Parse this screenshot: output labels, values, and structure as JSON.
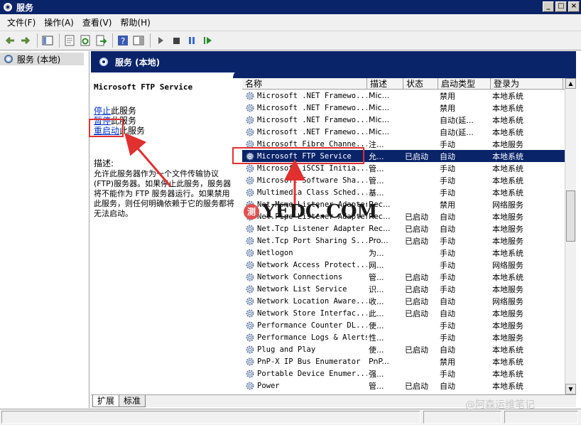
{
  "window": {
    "title": "服务",
    "buttons": [
      "_",
      "□",
      "×"
    ]
  },
  "menu": [
    "文件(F)",
    "操作(A)",
    "查看(V)",
    "帮助(H)"
  ],
  "toolbar": {
    "icons": [
      "back-icon",
      "forward-icon",
      "show-tree-icon",
      "properties-icon",
      "refresh-icon",
      "export-icon",
      "help-icon",
      "show-hide-icon",
      "start-icon",
      "stop-icon",
      "pause-icon",
      "restart-icon"
    ]
  },
  "tree": {
    "root_label": "服务 (本地)"
  },
  "main_header": {
    "label": "服务 (本地)"
  },
  "detail": {
    "service_title": "Microsoft FTP Service",
    "stop_link": "停止",
    "stop_suffix": "此服务",
    "pause_link": "暂停",
    "pause_suffix": "此服务",
    "restart_link": "重启动",
    "restart_suffix": "此服务",
    "desc_label": "描述:",
    "desc_text": "允许此服务器作为一个文件传输协议(FTP)服务器。如果停止此服务，服务器将不能作为 FTP 服务器运行。如果禁用此服务，则任何明确依赖于它的服务都将无法启动。"
  },
  "list": {
    "columns": [
      "名称",
      "描述",
      "状态",
      "启动类型",
      "登录为"
    ],
    "rows": [
      {
        "name": "Microsoft .NET Framewo...",
        "desc": "Mic...",
        "status": "",
        "type": "禁用",
        "logon": "本地系统"
      },
      {
        "name": "Microsoft .NET Framewo...",
        "desc": "Mic...",
        "status": "",
        "type": "禁用",
        "logon": "本地系统"
      },
      {
        "name": "Microsoft .NET Framewo...",
        "desc": "Mic...",
        "status": "",
        "type": "自动(延...",
        "logon": "本地系统"
      },
      {
        "name": "Microsoft .NET Framewo...",
        "desc": "Mic...",
        "status": "",
        "type": "自动(延...",
        "logon": "本地系统"
      },
      {
        "name": "Microsoft Fibre Channe...",
        "desc": "注...",
        "status": "",
        "type": "手动",
        "logon": "本地服务"
      },
      {
        "name": "Microsoft FTP Service",
        "desc": "允...",
        "status": "已启动",
        "type": "自动",
        "logon": "本地系统"
      },
      {
        "name": "Microsoft iSCSI Initia...",
        "desc": "管...",
        "status": "",
        "type": "手动",
        "logon": "本地系统"
      },
      {
        "name": "Microsoft Software Sha...",
        "desc": "管...",
        "status": "",
        "type": "手动",
        "logon": "本地系统"
      },
      {
        "name": "Multimedia Class Sched...",
        "desc": "基...",
        "status": "",
        "type": "手动",
        "logon": "本地系统"
      },
      {
        "name": "Net.Msmq Listener Adapter",
        "desc": "Rec...",
        "status": "",
        "type": "禁用",
        "logon": "网络服务"
      },
      {
        "name": "Net.Pipe Listener Adapter",
        "desc": "Rec...",
        "status": "已启动",
        "type": "自动",
        "logon": "本地服务"
      },
      {
        "name": "Net.Tcp Listener Adapter",
        "desc": "Rec...",
        "status": "已启动",
        "type": "自动",
        "logon": "本地服务"
      },
      {
        "name": "Net.Tcp Port Sharing S...",
        "desc": "Pro...",
        "status": "已启动",
        "type": "手动",
        "logon": "本地服务"
      },
      {
        "name": "Netlogon",
        "desc": "为...",
        "status": "",
        "type": "手动",
        "logon": "本地系统"
      },
      {
        "name": "Network Access Protect...",
        "desc": "网...",
        "status": "",
        "type": "手动",
        "logon": "网络服务"
      },
      {
        "name": "Network Connections",
        "desc": "管...",
        "status": "已启动",
        "type": "手动",
        "logon": "本地系统"
      },
      {
        "name": "Network List Service",
        "desc": "识...",
        "status": "已启动",
        "type": "手动",
        "logon": "本地服务"
      },
      {
        "name": "Network Location Aware...",
        "desc": "收...",
        "status": "已启动",
        "type": "自动",
        "logon": "网络服务"
      },
      {
        "name": "Network Store Interfac...",
        "desc": "此...",
        "status": "已启动",
        "type": "自动",
        "logon": "本地服务"
      },
      {
        "name": "Performance Counter DL...",
        "desc": "使...",
        "status": "",
        "type": "手动",
        "logon": "本地服务"
      },
      {
        "name": "Performance Logs & Alerts",
        "desc": "性...",
        "status": "",
        "type": "手动",
        "logon": "本地服务"
      },
      {
        "name": "Plug and Play",
        "desc": "使...",
        "status": "已启动",
        "type": "自动",
        "logon": "本地系统"
      },
      {
        "name": "PnP-X IP Bus Enumerator",
        "desc": "PnP...",
        "status": "",
        "type": "禁用",
        "logon": "本地系统"
      },
      {
        "name": "Portable Device Enumer...",
        "desc": "强...",
        "status": "",
        "type": "手动",
        "logon": "本地系统"
      },
      {
        "name": "Power",
        "desc": "管...",
        "status": "已启动",
        "type": "自动",
        "logon": "本地系统"
      }
    ],
    "selected_index": 5
  },
  "tabs": [
    "扩展",
    "标准"
  ],
  "watermark": {
    "badge": "测",
    "text": "YEDC.COM",
    "corner": "@阿森运维笔记"
  }
}
